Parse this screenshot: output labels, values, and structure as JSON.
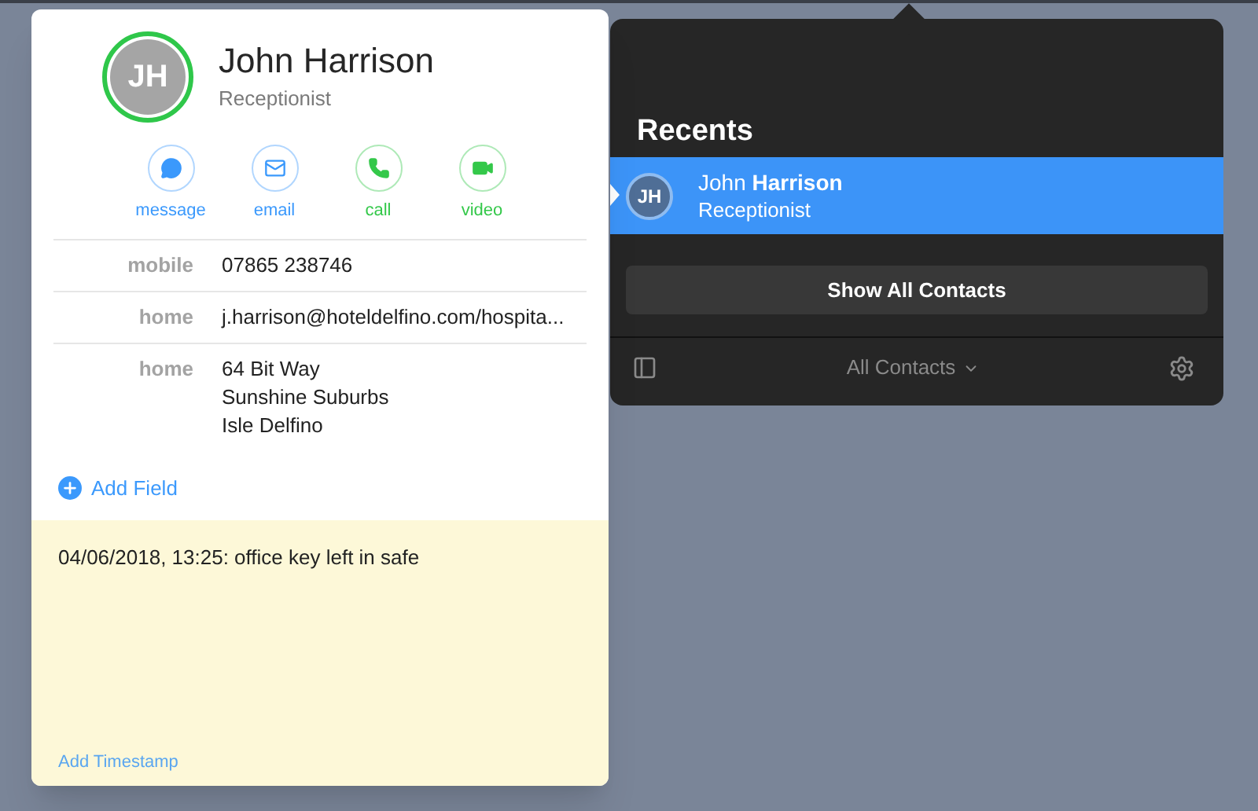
{
  "contact_card": {
    "initials": "JH",
    "name": "John Harrison",
    "title": "Receptionist",
    "actions": [
      {
        "label": "message",
        "kind": "message",
        "color": "#3b99fc"
      },
      {
        "label": "email",
        "kind": "email",
        "color": "#3b99fc"
      },
      {
        "label": "call",
        "kind": "call",
        "color": "#34c84a"
      },
      {
        "label": "video",
        "kind": "video",
        "color": "#34c84a"
      }
    ],
    "fields": [
      {
        "label": "mobile",
        "lines": [
          "07865 238746"
        ]
      },
      {
        "label": "home",
        "lines": [
          "j.harrison@hoteldelfino.com/hospita..."
        ]
      },
      {
        "label": "home",
        "lines": [
          "64 Bit Way",
          "Sunshine Suburbs",
          "Isle Delfino"
        ]
      }
    ],
    "add_field": "Add Field",
    "note": "04/06/2018, 13:25: office key left in safe",
    "add_timestamp": "Add Timestamp"
  },
  "recents_panel": {
    "heading": "Recents",
    "items": [
      {
        "initials": "JH",
        "name": "John **Harrison**",
        "subtitle": "Receptionist",
        "selected": true
      }
    ],
    "show_all_button": "Show All Contacts",
    "group_menu": "All Contacts"
  }
}
